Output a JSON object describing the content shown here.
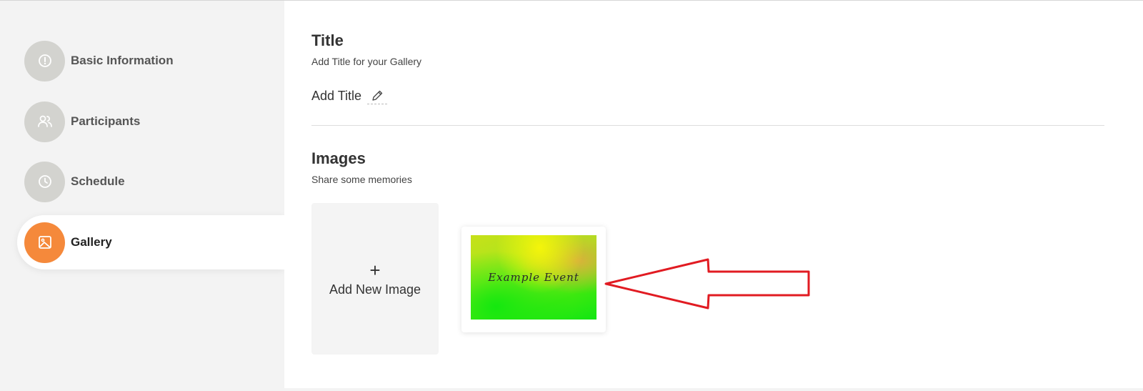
{
  "sidebar": {
    "items": [
      {
        "label": "Basic Information",
        "icon": "info-circle-icon",
        "active": false
      },
      {
        "label": "Participants",
        "icon": "users-icon",
        "active": false
      },
      {
        "label": "Schedule",
        "icon": "clock-icon",
        "active": false
      },
      {
        "label": "Gallery",
        "icon": "image-icon",
        "active": true
      }
    ]
  },
  "title_section": {
    "heading": "Title",
    "subheading": "Add Title for your Gallery",
    "add_title_label": "Add Title"
  },
  "images_section": {
    "heading": "Images",
    "subheading": "Share some memories",
    "add_new_label": "Add New Image",
    "images": [
      {
        "caption": "Example Event"
      }
    ]
  },
  "colors": {
    "accent": "#f5893b",
    "annotation_arrow": "#e11b22"
  }
}
